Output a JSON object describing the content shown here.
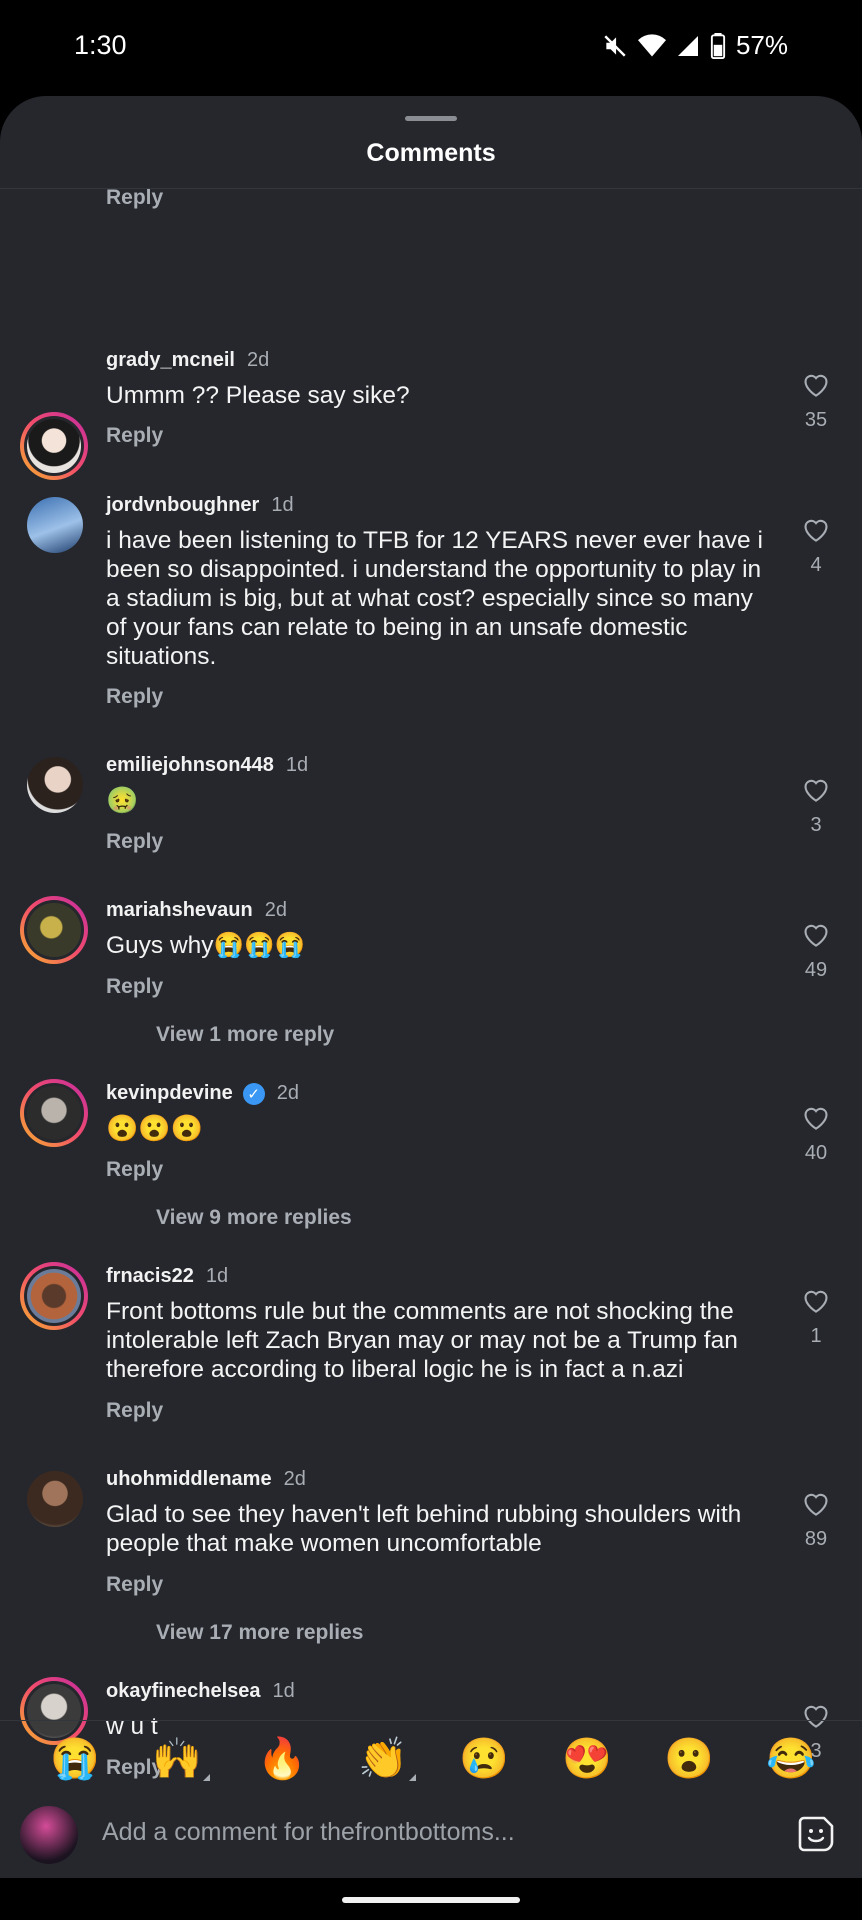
{
  "status": {
    "time": "1:30",
    "battery": "57%"
  },
  "sheet": {
    "title": "Comments",
    "top_reply": "Reply"
  },
  "comments": [
    {
      "user": "grady_mcneil",
      "age": "2d",
      "text": "Ummm ?? Please say sike?",
      "reply": "Reply",
      "likes": "35"
    },
    {
      "user": "jordvnboughner",
      "age": "1d",
      "text": "i have been listening to TFB for 12 YEARS never ever have i been so disappointed. i understand the opportunity to play in a stadium is big, but at what cost? especially since so many of your fans can relate to being in an unsafe domestic situations.",
      "reply": "Reply",
      "likes": "4"
    },
    {
      "user": "emiliejohnson448",
      "age": "1d",
      "text": "🤢",
      "reply": "Reply",
      "likes": "3"
    },
    {
      "user": "mariahshevaun",
      "age": "2d",
      "text": "Guys why😭😭😭",
      "reply": "Reply",
      "likes": "49",
      "more": "View 1 more reply"
    },
    {
      "user": "kevinpdevine",
      "age": "2d",
      "text": "😮😮😮",
      "reply": "Reply",
      "likes": "40",
      "more": "View 9 more replies",
      "verified": "✓"
    },
    {
      "user": "frnacis22",
      "age": "1d",
      "text": "Front bottoms rule but the comments are not shocking the intolerable left Zach Bryan may or may not be a Trump fan therefore according to liberal logic he is in fact a n.azi",
      "reply": "Reply",
      "likes": "1"
    },
    {
      "user": "uhohmiddlename",
      "age": "2d",
      "text": "Glad to see they haven't left behind rubbing shoulders with people that make women uncomfortable",
      "reply": "Reply",
      "likes": "89",
      "more": "View 17 more replies"
    },
    {
      "user": "okayfinechelsea",
      "age": "1d",
      "text": "w u t",
      "reply": "Reply",
      "likes": "3"
    }
  ],
  "emoji_bar": [
    "😭",
    "🙌",
    "🔥",
    "👏",
    "😢",
    "😍",
    "😮",
    "😂"
  ],
  "composer": {
    "placeholder": "Add a comment for thefrontbottoms..."
  },
  "icons": {
    "heart": "heart-outline-icon",
    "sticker": "sticker-icon",
    "mute": "mute-icon",
    "wifi": "wifi-icon",
    "signal": "signal-icon",
    "battery": "battery-icon"
  },
  "colors": {
    "background": "#25272d",
    "muted_text": "#a9adb4",
    "story_ring": "#f24d6b",
    "verified": "#3a97f3"
  }
}
